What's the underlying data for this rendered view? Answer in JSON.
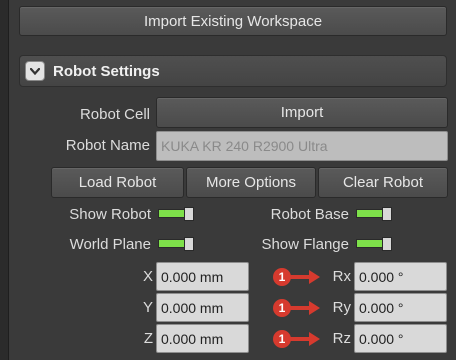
{
  "workspace": {
    "import_label": "Import Existing Workspace"
  },
  "robot_settings": {
    "title": "Robot Settings",
    "cell": {
      "label": "Robot Cell",
      "import_label": "Import"
    },
    "name": {
      "label": "Robot Name",
      "value": "KUKA KR 240 R2900 Ultra"
    },
    "buttons": {
      "load": "Load Robot",
      "more": "More Options",
      "clear": "Clear Robot"
    },
    "toggles": {
      "show_robot": {
        "label": "Show Robot",
        "on": true
      },
      "robot_base": {
        "label": "Robot Base",
        "on": true
      },
      "world_plane": {
        "label": "World Plane",
        "on": true
      },
      "show_flange": {
        "label": "Show Flange",
        "on": true
      }
    },
    "position": {
      "x": {
        "label": "X",
        "value": "0.000 mm"
      },
      "y": {
        "label": "Y",
        "value": "0.000 mm"
      },
      "z": {
        "label": "Z",
        "value": "0.000 mm"
      }
    },
    "rotation": {
      "rx": {
        "label": "Rx",
        "value": "0.000 °",
        "marker": "1"
      },
      "ry": {
        "label": "Ry",
        "value": "0.000 °",
        "marker": "1"
      },
      "rz": {
        "label": "Rz",
        "value": "0.000 °",
        "marker": "1"
      }
    }
  },
  "colors": {
    "toggle_on": "#7ee04a",
    "marker": "#d63a2e",
    "panel": "#3a3a3a"
  }
}
